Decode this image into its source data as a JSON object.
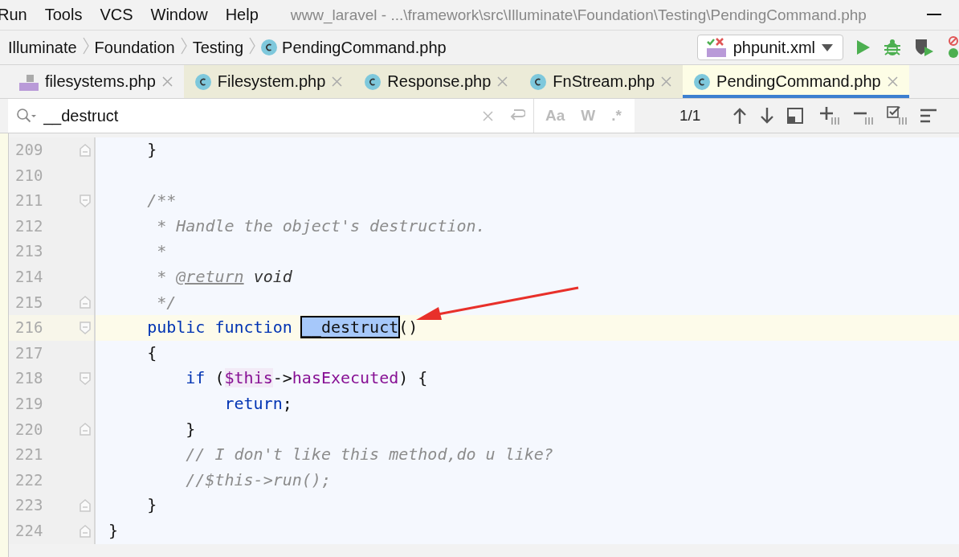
{
  "menu": [
    "Run",
    "Tools",
    "VCS",
    "Window",
    "Help"
  ],
  "window": {
    "title": "www_laravel - ...\\framework\\src\\Illuminate\\Foundation\\Testing\\PendingCommand.php"
  },
  "breadcrumb": [
    {
      "label": "Illuminate",
      "kind": "folder"
    },
    {
      "label": "Foundation",
      "kind": "folder"
    },
    {
      "label": "Testing",
      "kind": "folder"
    },
    {
      "label": "PendingCommand.php",
      "kind": "class"
    }
  ],
  "run_config": {
    "label": "phpunit.xml"
  },
  "tabs": [
    {
      "label": "filesystems.php",
      "kind": "php",
      "selected": false
    },
    {
      "label": "Filesystem.php",
      "kind": "class",
      "selected": false
    },
    {
      "label": "Response.php",
      "kind": "class",
      "selected": false
    },
    {
      "label": "FnStream.php",
      "kind": "class",
      "selected": false
    },
    {
      "label": "PendingCommand.php",
      "kind": "class",
      "selected": true
    }
  ],
  "search": {
    "value": "__destruct",
    "options": [
      "Aa",
      "W",
      ".*"
    ],
    "count": "1/1"
  },
  "lines": [
    {
      "number": "209",
      "fold_start": false,
      "fold_end": true,
      "current": false,
      "tokens": [
        {
          "kind": "plain",
          "text": "    }"
        }
      ]
    },
    {
      "number": "210",
      "fold_start": false,
      "fold_end": false,
      "current": false
    },
    {
      "number": "211",
      "fold_start": true,
      "fold_end": false,
      "current": false,
      "tokens": [
        {
          "kind": "comment",
          "text": "    /**"
        }
      ]
    },
    {
      "number": "212",
      "fold_start": false,
      "fold_end": false,
      "current": false,
      "tokens": [
        {
          "kind": "comment",
          "text": "     * Handle the object's destruction."
        }
      ]
    },
    {
      "number": "213",
      "fold_start": false,
      "fold_end": false,
      "current": false,
      "tokens": [
        {
          "kind": "comment",
          "text": "     *"
        }
      ]
    },
    {
      "number": "214",
      "fold_start": false,
      "fold_end": false,
      "current": false,
      "tokens": [
        {
          "kind": "comment",
          "text": "     * "
        },
        {
          "kind": "doctag",
          "text": "@return"
        },
        {
          "kind": "doctype",
          "text": " void"
        }
      ]
    },
    {
      "number": "215",
      "fold_start": false,
      "fold_end": true,
      "current": false,
      "tokens": [
        {
          "kind": "comment",
          "text": "     */"
        }
      ]
    },
    {
      "number": "216",
      "fold_start": true,
      "fold_end": false,
      "current": true,
      "tokens": [
        {
          "kind": "keyword",
          "text": "    public function "
        },
        {
          "kind": "match",
          "text": "__destruct"
        },
        {
          "kind": "plain",
          "text": "()"
        }
      ]
    },
    {
      "number": "217",
      "fold_start": false,
      "fold_end": false,
      "current": false,
      "tokens": [
        {
          "kind": "plain",
          "text": "    {"
        }
      ]
    },
    {
      "number": "218",
      "fold_start": true,
      "fold_end": false,
      "current": false,
      "tokens": [
        {
          "kind": "keyword",
          "text": "        if"
        },
        {
          "kind": "plain",
          "text": " ("
        },
        {
          "kind": "variable",
          "text": "$this"
        },
        {
          "kind": "plain",
          "text": "->"
        },
        {
          "kind": "property",
          "text": "hasExecuted"
        },
        {
          "kind": "plain",
          "text": ") {"
        }
      ]
    },
    {
      "number": "219",
      "fold_start": false,
      "fold_end": false,
      "current": false,
      "tokens": [
        {
          "kind": "keyword",
          "text": "            return"
        },
        {
          "kind": "plain",
          "text": ";"
        }
      ]
    },
    {
      "number": "220",
      "fold_start": false,
      "fold_end": true,
      "current": false,
      "tokens": [
        {
          "kind": "plain",
          "text": "        }"
        }
      ]
    },
    {
      "number": "221",
      "fold_start": false,
      "fold_end": false,
      "current": false,
      "tokens": [
        {
          "kind": "comment",
          "text": "        // I don't like this method,do u like?"
        }
      ]
    },
    {
      "number": "222",
      "fold_start": false,
      "fold_end": false,
      "current": false,
      "tokens": [
        {
          "kind": "comment",
          "text": "        //$this->run();"
        }
      ]
    },
    {
      "number": "223",
      "fold_start": false,
      "fold_end": true,
      "current": false,
      "tokens": [
        {
          "kind": "plain",
          "text": "    }"
        }
      ]
    },
    {
      "number": "224",
      "fold_start": false,
      "fold_end": true,
      "current": false,
      "tokens": [
        {
          "kind": "plain",
          "text": "}"
        }
      ]
    }
  ]
}
